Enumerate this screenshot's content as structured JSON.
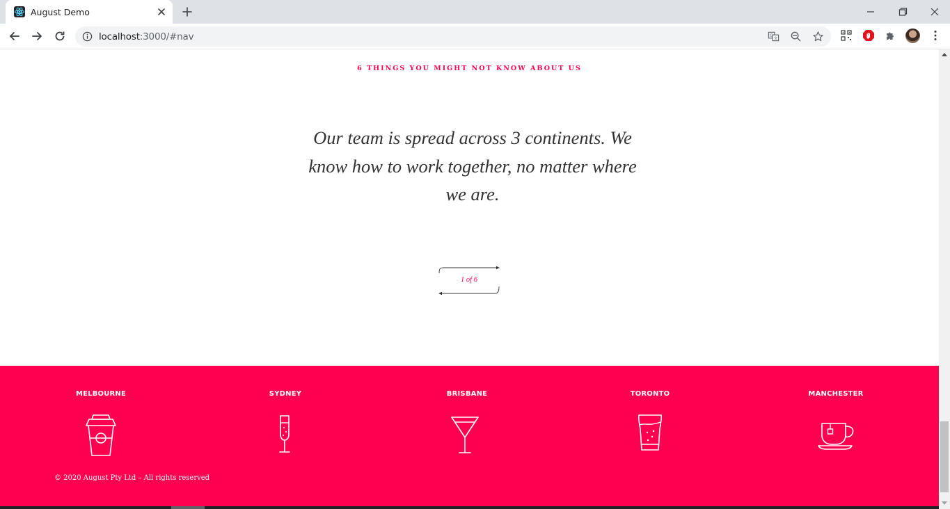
{
  "browser": {
    "tab_title": "August Demo",
    "url_host": "localhost",
    "url_rest": ":3000/#nav",
    "icons": [
      "react-favicon",
      "close-icon",
      "plus-icon",
      "minimize-icon",
      "restore-icon",
      "close-window-icon",
      "back-icon",
      "forward-icon",
      "reload-icon",
      "info-icon",
      "translate-icon",
      "zoom-out-icon",
      "star-icon",
      "qr-icon",
      "adblock-icon",
      "puzzle-icon",
      "avatar",
      "kebab-menu-icon"
    ]
  },
  "page": {
    "eyebrow": "6 THINGS YOU MIGHT NOT KNOW ABOUT US",
    "quote_lines": [
      "Our team is spread across 3 continents. We",
      "know how to work together, no matter where",
      "we are."
    ],
    "pager_label": "1 of 6"
  },
  "footer": {
    "cities": [
      {
        "name": "MELBOURNE",
        "icon": "coffee-cup-icon"
      },
      {
        "name": "SYDNEY",
        "icon": "champagne-glass-icon"
      },
      {
        "name": "BRISBANE",
        "icon": "martini-glass-icon"
      },
      {
        "name": "TORONTO",
        "icon": "beer-glass-icon"
      },
      {
        "name": "MANCHESTER",
        "icon": "tea-cup-icon"
      }
    ],
    "copyright": "© 2020 August Pty Ltd – All rights reserved"
  },
  "colors": {
    "accent": "#ff0050",
    "text": "#333333",
    "chrome_bg": "#dee1e6"
  }
}
